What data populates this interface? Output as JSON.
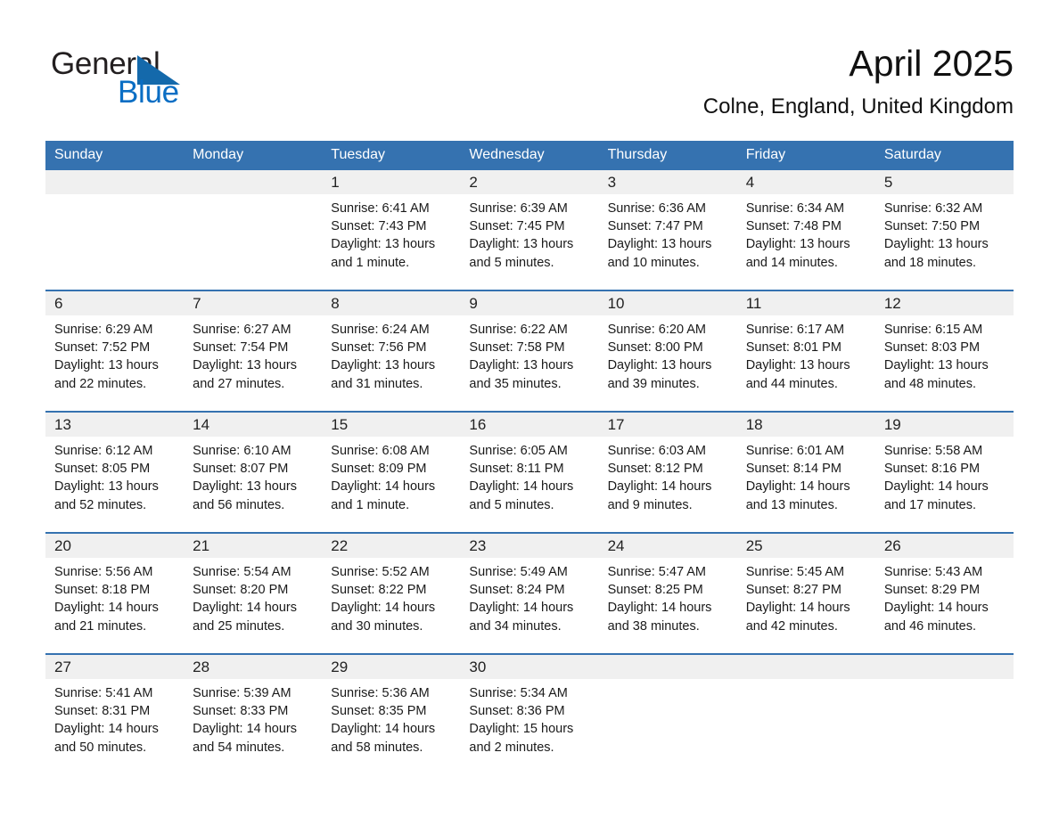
{
  "brand": {
    "name_part1": "General",
    "name_part2": "Blue",
    "accent_color": "#1469ab",
    "blue_text_color": "#0a6ec4"
  },
  "header": {
    "month_title": "April 2025",
    "location": "Colne, England, United Kingdom"
  },
  "theme": {
    "header_row_bg": "#3572b0",
    "daynum_band_bg": "#f0f0f0",
    "row_divider": "#3572b0"
  },
  "weekday_headers": [
    "Sunday",
    "Monday",
    "Tuesday",
    "Wednesday",
    "Thursday",
    "Friday",
    "Saturday"
  ],
  "weeks": [
    [
      {
        "day": "",
        "sunrise": "",
        "sunset": "",
        "daylight_line1": "",
        "daylight_line2": ""
      },
      {
        "day": "",
        "sunrise": "",
        "sunset": "",
        "daylight_line1": "",
        "daylight_line2": ""
      },
      {
        "day": "1",
        "sunrise": "Sunrise: 6:41 AM",
        "sunset": "Sunset: 7:43 PM",
        "daylight_line1": "Daylight: 13 hours",
        "daylight_line2": "and 1 minute."
      },
      {
        "day": "2",
        "sunrise": "Sunrise: 6:39 AM",
        "sunset": "Sunset: 7:45 PM",
        "daylight_line1": "Daylight: 13 hours",
        "daylight_line2": "and 5 minutes."
      },
      {
        "day": "3",
        "sunrise": "Sunrise: 6:36 AM",
        "sunset": "Sunset: 7:47 PM",
        "daylight_line1": "Daylight: 13 hours",
        "daylight_line2": "and 10 minutes."
      },
      {
        "day": "4",
        "sunrise": "Sunrise: 6:34 AM",
        "sunset": "Sunset: 7:48 PM",
        "daylight_line1": "Daylight: 13 hours",
        "daylight_line2": "and 14 minutes."
      },
      {
        "day": "5",
        "sunrise": "Sunrise: 6:32 AM",
        "sunset": "Sunset: 7:50 PM",
        "daylight_line1": "Daylight: 13 hours",
        "daylight_line2": "and 18 minutes."
      }
    ],
    [
      {
        "day": "6",
        "sunrise": "Sunrise: 6:29 AM",
        "sunset": "Sunset: 7:52 PM",
        "daylight_line1": "Daylight: 13 hours",
        "daylight_line2": "and 22 minutes."
      },
      {
        "day": "7",
        "sunrise": "Sunrise: 6:27 AM",
        "sunset": "Sunset: 7:54 PM",
        "daylight_line1": "Daylight: 13 hours",
        "daylight_line2": "and 27 minutes."
      },
      {
        "day": "8",
        "sunrise": "Sunrise: 6:24 AM",
        "sunset": "Sunset: 7:56 PM",
        "daylight_line1": "Daylight: 13 hours",
        "daylight_line2": "and 31 minutes."
      },
      {
        "day": "9",
        "sunrise": "Sunrise: 6:22 AM",
        "sunset": "Sunset: 7:58 PM",
        "daylight_line1": "Daylight: 13 hours",
        "daylight_line2": "and 35 minutes."
      },
      {
        "day": "10",
        "sunrise": "Sunrise: 6:20 AM",
        "sunset": "Sunset: 8:00 PM",
        "daylight_line1": "Daylight: 13 hours",
        "daylight_line2": "and 39 minutes."
      },
      {
        "day": "11",
        "sunrise": "Sunrise: 6:17 AM",
        "sunset": "Sunset: 8:01 PM",
        "daylight_line1": "Daylight: 13 hours",
        "daylight_line2": "and 44 minutes."
      },
      {
        "day": "12",
        "sunrise": "Sunrise: 6:15 AM",
        "sunset": "Sunset: 8:03 PM",
        "daylight_line1": "Daylight: 13 hours",
        "daylight_line2": "and 48 minutes."
      }
    ],
    [
      {
        "day": "13",
        "sunrise": "Sunrise: 6:12 AM",
        "sunset": "Sunset: 8:05 PM",
        "daylight_line1": "Daylight: 13 hours",
        "daylight_line2": "and 52 minutes."
      },
      {
        "day": "14",
        "sunrise": "Sunrise: 6:10 AM",
        "sunset": "Sunset: 8:07 PM",
        "daylight_line1": "Daylight: 13 hours",
        "daylight_line2": "and 56 minutes."
      },
      {
        "day": "15",
        "sunrise": "Sunrise: 6:08 AM",
        "sunset": "Sunset: 8:09 PM",
        "daylight_line1": "Daylight: 14 hours",
        "daylight_line2": "and 1 minute."
      },
      {
        "day": "16",
        "sunrise": "Sunrise: 6:05 AM",
        "sunset": "Sunset: 8:11 PM",
        "daylight_line1": "Daylight: 14 hours",
        "daylight_line2": "and 5 minutes."
      },
      {
        "day": "17",
        "sunrise": "Sunrise: 6:03 AM",
        "sunset": "Sunset: 8:12 PM",
        "daylight_line1": "Daylight: 14 hours",
        "daylight_line2": "and 9 minutes."
      },
      {
        "day": "18",
        "sunrise": "Sunrise: 6:01 AM",
        "sunset": "Sunset: 8:14 PM",
        "daylight_line1": "Daylight: 14 hours",
        "daylight_line2": "and 13 minutes."
      },
      {
        "day": "19",
        "sunrise": "Sunrise: 5:58 AM",
        "sunset": "Sunset: 8:16 PM",
        "daylight_line1": "Daylight: 14 hours",
        "daylight_line2": "and 17 minutes."
      }
    ],
    [
      {
        "day": "20",
        "sunrise": "Sunrise: 5:56 AM",
        "sunset": "Sunset: 8:18 PM",
        "daylight_line1": "Daylight: 14 hours",
        "daylight_line2": "and 21 minutes."
      },
      {
        "day": "21",
        "sunrise": "Sunrise: 5:54 AM",
        "sunset": "Sunset: 8:20 PM",
        "daylight_line1": "Daylight: 14 hours",
        "daylight_line2": "and 25 minutes."
      },
      {
        "day": "22",
        "sunrise": "Sunrise: 5:52 AM",
        "sunset": "Sunset: 8:22 PM",
        "daylight_line1": "Daylight: 14 hours",
        "daylight_line2": "and 30 minutes."
      },
      {
        "day": "23",
        "sunrise": "Sunrise: 5:49 AM",
        "sunset": "Sunset: 8:24 PM",
        "daylight_line1": "Daylight: 14 hours",
        "daylight_line2": "and 34 minutes."
      },
      {
        "day": "24",
        "sunrise": "Sunrise: 5:47 AM",
        "sunset": "Sunset: 8:25 PM",
        "daylight_line1": "Daylight: 14 hours",
        "daylight_line2": "and 38 minutes."
      },
      {
        "day": "25",
        "sunrise": "Sunrise: 5:45 AM",
        "sunset": "Sunset: 8:27 PM",
        "daylight_line1": "Daylight: 14 hours",
        "daylight_line2": "and 42 minutes."
      },
      {
        "day": "26",
        "sunrise": "Sunrise: 5:43 AM",
        "sunset": "Sunset: 8:29 PM",
        "daylight_line1": "Daylight: 14 hours",
        "daylight_line2": "and 46 minutes."
      }
    ],
    [
      {
        "day": "27",
        "sunrise": "Sunrise: 5:41 AM",
        "sunset": "Sunset: 8:31 PM",
        "daylight_line1": "Daylight: 14 hours",
        "daylight_line2": "and 50 minutes."
      },
      {
        "day": "28",
        "sunrise": "Sunrise: 5:39 AM",
        "sunset": "Sunset: 8:33 PM",
        "daylight_line1": "Daylight: 14 hours",
        "daylight_line2": "and 54 minutes."
      },
      {
        "day": "29",
        "sunrise": "Sunrise: 5:36 AM",
        "sunset": "Sunset: 8:35 PM",
        "daylight_line1": "Daylight: 14 hours",
        "daylight_line2": "and 58 minutes."
      },
      {
        "day": "30",
        "sunrise": "Sunrise: 5:34 AM",
        "sunset": "Sunset: 8:36 PM",
        "daylight_line1": "Daylight: 15 hours",
        "daylight_line2": "and 2 minutes."
      },
      {
        "day": "",
        "sunrise": "",
        "sunset": "",
        "daylight_line1": "",
        "daylight_line2": ""
      },
      {
        "day": "",
        "sunrise": "",
        "sunset": "",
        "daylight_line1": "",
        "daylight_line2": ""
      },
      {
        "day": "",
        "sunrise": "",
        "sunset": "",
        "daylight_line1": "",
        "daylight_line2": ""
      }
    ]
  ]
}
